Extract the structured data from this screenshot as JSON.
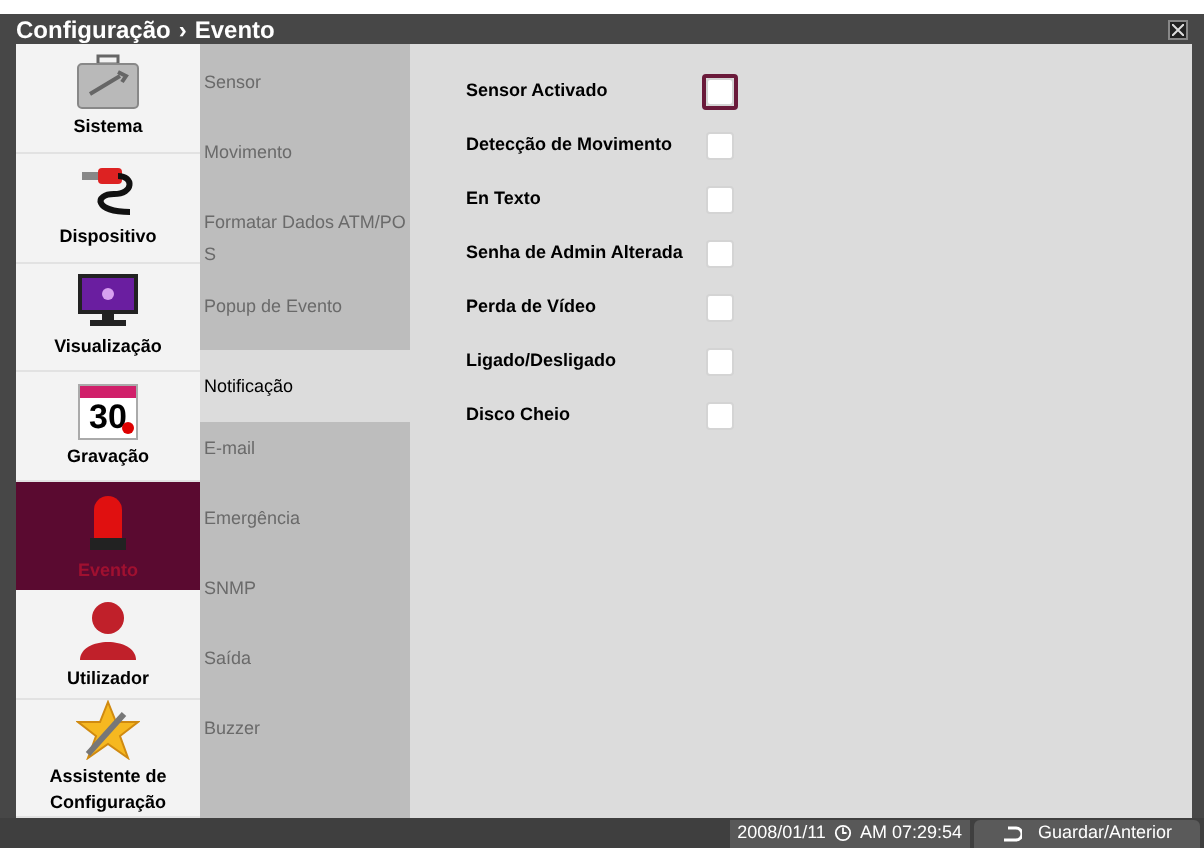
{
  "header": {
    "breadcrumb": [
      "Configuração",
      "Evento"
    ],
    "separator": "›"
  },
  "sidebar": {
    "items": [
      {
        "label": "Sistema",
        "kind": "toolbox",
        "selected": false
      },
      {
        "label": "Dispositivo",
        "kind": "cable",
        "selected": false
      },
      {
        "label": "Visualização",
        "kind": "monitor",
        "selected": false
      },
      {
        "label": "Gravação",
        "kind": "calendar",
        "selected": false,
        "icon_text": "30"
      },
      {
        "label": "Evento",
        "kind": "siren",
        "selected": true
      },
      {
        "label": "Utilizador",
        "kind": "user",
        "selected": false
      },
      {
        "label": "Assistente de Configuração",
        "kind": "star",
        "selected": false
      }
    ]
  },
  "submenu": {
    "items": [
      {
        "label": "Sensor",
        "selected": false
      },
      {
        "label": "Movimento",
        "selected": false
      },
      {
        "label": "Formatar Dados ATM/PO S",
        "selected": false
      },
      {
        "label": "Popup de Evento",
        "selected": false
      },
      {
        "label": "Notificação",
        "selected": true
      },
      {
        "label": "E-mail",
        "selected": false
      },
      {
        "label": "Emergência",
        "selected": false
      },
      {
        "label": "SNMP",
        "selected": false
      },
      {
        "label": "Saída",
        "selected": false
      },
      {
        "label": "Buzzer",
        "selected": false
      }
    ]
  },
  "options": [
    {
      "label": "Sensor Activado",
      "checked": false,
      "focused": true
    },
    {
      "label": "Detecção de Movimento",
      "checked": false,
      "focused": false
    },
    {
      "label": "En Texto",
      "checked": false,
      "focused": false
    },
    {
      "label": "Senha de Admin Alterada",
      "checked": false,
      "focused": false
    },
    {
      "label": "Perda de Vídeo",
      "checked": false,
      "focused": false
    },
    {
      "label": "Ligado/Desligado",
      "checked": false,
      "focused": false
    },
    {
      "label": "Disco Cheio",
      "checked": false,
      "focused": false
    }
  ],
  "status_bar": {
    "date": "2008/01/11",
    "time": "AM 07:29:54",
    "button": "Guardar/Anterior"
  }
}
